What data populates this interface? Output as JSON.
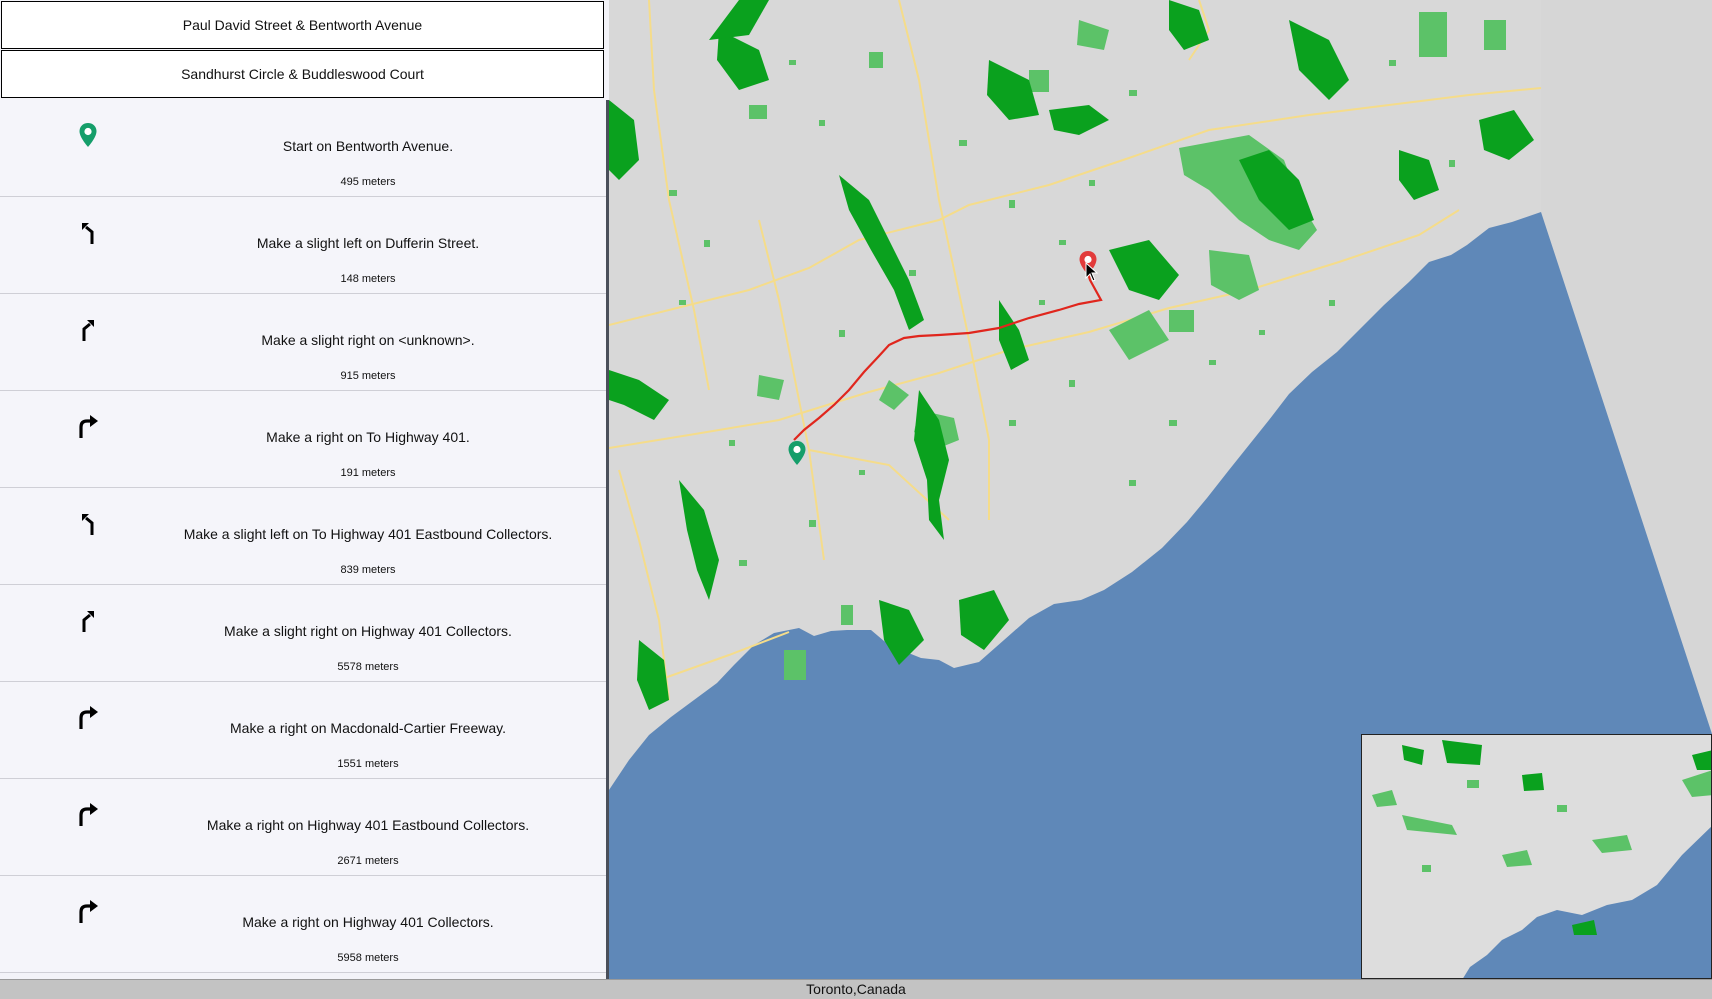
{
  "origin": "Paul David Street & Bentworth Avenue",
  "destination": "Sandhurst Circle & Buddleswood Court",
  "steps": [
    {
      "icon": "start-pin-icon",
      "instruction": "Start on Bentworth Avenue.",
      "distance": "495 meters"
    },
    {
      "icon": "slight-left-icon",
      "instruction": "Make a slight left on Dufferin Street.",
      "distance": "148 meters"
    },
    {
      "icon": "slight-right-icon",
      "instruction": "Make a slight right on <unknown>.",
      "distance": "915 meters"
    },
    {
      "icon": "turn-right-icon",
      "instruction": "Make a right on To Highway 401.",
      "distance": "191 meters"
    },
    {
      "icon": "slight-left-icon",
      "instruction": "Make a slight left on To Highway 401 Eastbound Collectors.",
      "distance": "839 meters"
    },
    {
      "icon": "slight-right-icon",
      "instruction": "Make a slight right on Highway 401 Collectors.",
      "distance": "5578 meters"
    },
    {
      "icon": "turn-right-icon",
      "instruction": "Make a right on Macdonald-Cartier Freeway.",
      "distance": "1551 meters"
    },
    {
      "icon": "turn-right-icon",
      "instruction": "Make a right on Highway 401 Eastbound Collectors.",
      "distance": "2671 meters"
    },
    {
      "icon": "turn-right-icon",
      "instruction": "Make a right on Highway 401 Collectors.",
      "distance": "5958 meters"
    }
  ],
  "status_text": "Toronto,Canada",
  "colors": {
    "land": "#d8d8d8",
    "water": "#5f88b8",
    "park": "#5cc268",
    "forest": "#0aa11e",
    "road": "#f5dc8a",
    "route": "#e0261d",
    "start_marker": "#159e6a",
    "end_marker": "#e23b3b"
  }
}
